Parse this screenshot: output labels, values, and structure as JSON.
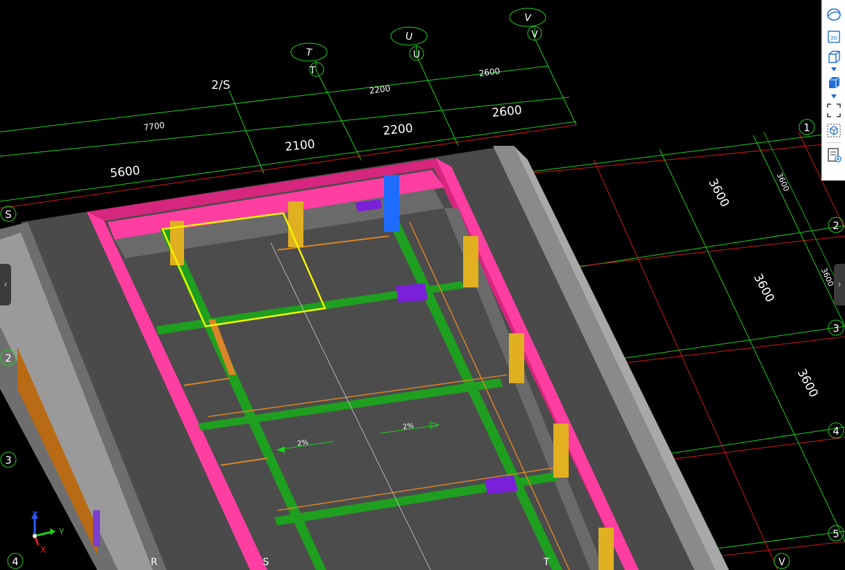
{
  "grid_axes": {
    "top_bubbles": [
      "T",
      "U",
      "V"
    ],
    "top_labels": [
      "T",
      "U",
      "V"
    ],
    "right_bubbles": [
      "1",
      "2",
      "3",
      "4",
      "5"
    ],
    "left_bubbles": [
      "S",
      "2",
      "3",
      "4"
    ],
    "bottom_labels": [
      "R",
      "S",
      "T",
      "V"
    ],
    "secondary_label": "2/S"
  },
  "dimensions": {
    "outer_top": [
      "7700",
      "2200",
      "2600"
    ],
    "inner_top": [
      "5600",
      "2100",
      "2200",
      "2600"
    ],
    "right_large": [
      "3600",
      "3600",
      "3600"
    ],
    "right_small": [
      "3600",
      "3600"
    ]
  },
  "slope_labels": [
    "2%",
    "2%"
  ],
  "axis_gizmo": {
    "x": "X",
    "y": "Y",
    "z": "Z"
  },
  "toolbar": {
    "items": [
      "orbit-icon",
      "view-2d-icon",
      "view-3d-icon",
      "solid-box-icon",
      "fit-view-icon",
      "section-box-icon",
      "properties-icon"
    ],
    "label_2d": "2D"
  },
  "colors": {
    "background": "#000000",
    "grid_green": "#1fd21f",
    "grid_red": "#d11a1a",
    "parapet_pink": "#ff3ea1",
    "beam_green": "#1f9f1f",
    "column_yellow": "#e0b020",
    "rebar_orange": "#d9852a",
    "selected_yellow": "#f4f400",
    "slab_gray": "#4a4a4a"
  }
}
